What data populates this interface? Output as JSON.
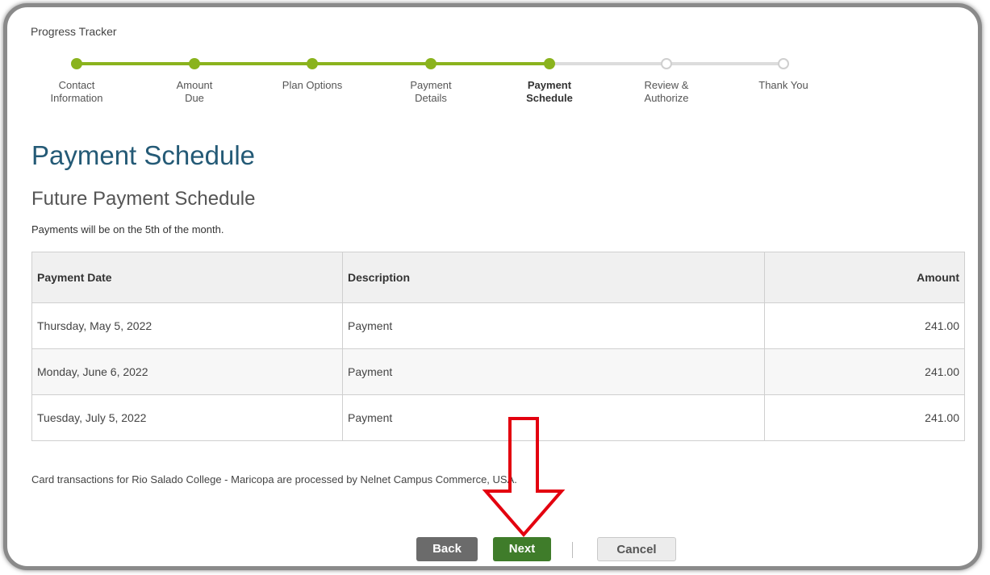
{
  "tracker": {
    "title": "Progress Tracker",
    "steps": [
      {
        "label": "Contact\nInformation",
        "state": "done"
      },
      {
        "label": "Amount\nDue",
        "state": "done"
      },
      {
        "label": "Plan Options",
        "state": "done"
      },
      {
        "label": "Payment\nDetails",
        "state": "done"
      },
      {
        "label": "Payment\nSchedule",
        "state": "current"
      },
      {
        "label": "Review &\nAuthorize",
        "state": "todo"
      },
      {
        "label": "Thank You",
        "state": "todo"
      }
    ],
    "colors": {
      "done": "#8ab31d",
      "todo": "#cfcfcf"
    }
  },
  "page": {
    "title": "Payment Schedule",
    "subtitle": "Future Payment Schedule",
    "note": "Payments will be on the 5th of the month."
  },
  "table": {
    "headers": {
      "date": "Payment Date",
      "description": "Description",
      "amount": "Amount"
    },
    "rows": [
      {
        "date": "Thursday, May 5, 2022",
        "description": "Payment",
        "amount": "241.00"
      },
      {
        "date": "Monday, June 6, 2022",
        "description": "Payment",
        "amount": "241.00"
      },
      {
        "date": "Tuesday, July 5, 2022",
        "description": "Payment",
        "amount": "241.00"
      }
    ]
  },
  "footer": {
    "disclaimer": "Card transactions for Rio Salado College - Maricopa are processed by Nelnet Campus Commerce, USA."
  },
  "buttons": {
    "back": "Back",
    "next": "Next",
    "cancel": "Cancel"
  },
  "annotation": {
    "arrow_color": "#e3000f",
    "arrow_icon": "down-arrow-icon"
  }
}
